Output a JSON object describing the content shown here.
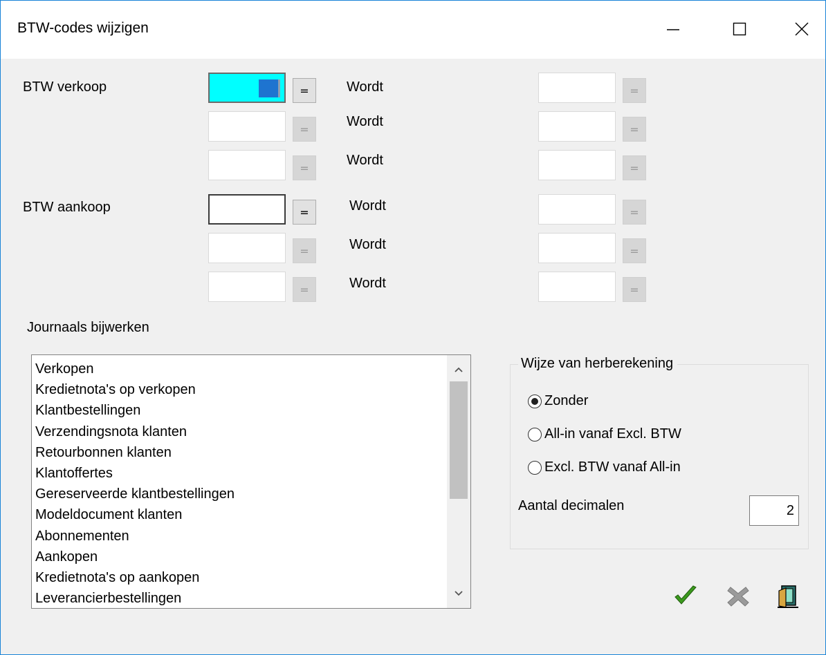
{
  "window": {
    "title": "BTW-codes wijzigen",
    "controls": [
      "minimize-icon",
      "maximize-icon",
      "close-icon"
    ]
  },
  "btw_verkoop": {
    "label": "BTW verkoop",
    "rows": [
      {
        "from_value": "",
        "equals": "=",
        "wordt": "Wordt",
        "to_value": "",
        "to_equals": "="
      },
      {
        "from_value": "",
        "equals": "=",
        "wordt": "Wordt",
        "to_value": "",
        "to_equals": "="
      },
      {
        "from_value": "",
        "equals": "=",
        "wordt": "Wordt",
        "to_value": "",
        "to_equals": "="
      }
    ]
  },
  "btw_aankoop": {
    "label": "BTW aankoop",
    "rows": [
      {
        "from_value": "",
        "equals": "=",
        "wordt": "Wordt",
        "to_value": "",
        "to_equals": "="
      },
      {
        "from_value": "",
        "equals": "=",
        "wordt": "Wordt",
        "to_value": "",
        "to_equals": "="
      },
      {
        "from_value": "",
        "equals": "=",
        "wordt": "Wordt",
        "to_value": "",
        "to_equals": "="
      }
    ]
  },
  "journals": {
    "label": "Journaals bijwerken",
    "items": [
      "Verkopen",
      "Kredietnota's op verkopen",
      "Klantbestellingen",
      "Verzendingsnota klanten",
      "Retourbonnen klanten",
      "Klantoffertes",
      "Gereserveerde klantbestellingen",
      "Modeldocument klanten",
      "Abonnementen",
      "Aankopen",
      "Kredietnota's op aankopen",
      "Leverancierbestellingen"
    ]
  },
  "recalc": {
    "label": "Wijze van herberekening",
    "options": [
      "Zonder",
      "All-in vanaf Excl. BTW",
      "Excl. BTW vanaf All-in"
    ],
    "selected": "Zonder",
    "decimals_label": "Aantal decimalen",
    "decimals_value": "2"
  },
  "toolbar": {
    "icons": [
      "checkmark-icon",
      "cancel-x-icon",
      "exit-door-icon"
    ],
    "confirm_color": "#3c9a1e",
    "cancel_color": "#9a9a9a"
  },
  "colors": {
    "active_field": "#00ffff",
    "window_border": "#1883d7"
  }
}
